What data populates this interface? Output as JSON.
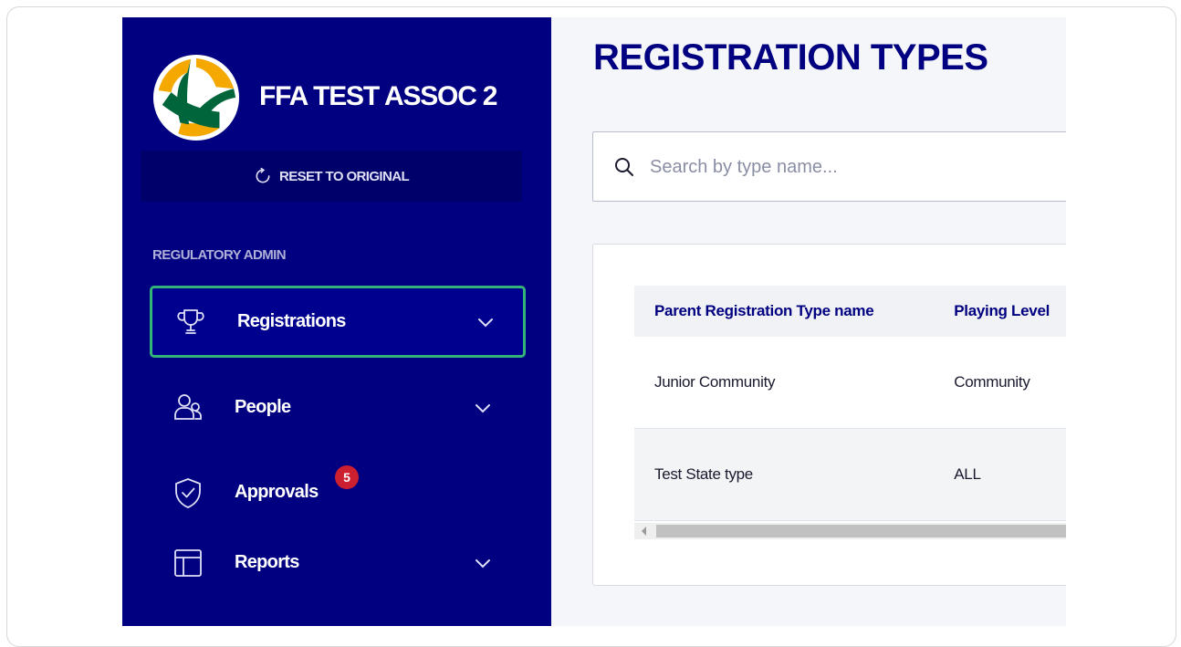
{
  "sidebar": {
    "org_name": "FFA TEST ASSOC 2",
    "reset_label": "RESET TO ORIGINAL",
    "section_title": "REGULATORY ADMIN",
    "items": [
      {
        "label": "Registrations",
        "icon": "trophy-icon",
        "active": true
      },
      {
        "label": "People",
        "icon": "people-icon"
      },
      {
        "label": "Approvals",
        "icon": "shield-check-icon",
        "badge": "5"
      },
      {
        "label": "Reports",
        "icon": "layout-icon"
      }
    ],
    "colors": {
      "bg": "#000080",
      "active_border": "#33b37a",
      "badge": "#cc1f30"
    }
  },
  "main": {
    "title": "REGISTRATION TYPES",
    "search": {
      "placeholder": "Search by type name...",
      "clear": "×"
    },
    "table": {
      "columns": [
        "Parent Registration Type name",
        "Playing Level"
      ],
      "rows": [
        [
          "Junior Community",
          "Community"
        ],
        [
          "Test State type",
          "ALL"
        ]
      ]
    }
  }
}
